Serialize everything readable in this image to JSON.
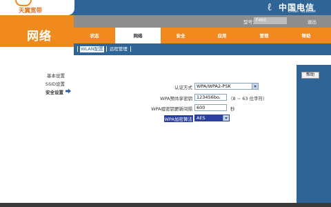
{
  "header": {
    "logo_text": "天翼宽带",
    "telecom_cn": "中国电信",
    "telecom_en": "CHINA TELECOM"
  },
  "section_title": "网络",
  "status_bar": {
    "model_label": "型号：",
    "model_value": "F460",
    "exit_label": "退出"
  },
  "main_tabs": [
    {
      "label": "状态",
      "active": false
    },
    {
      "label": "网络",
      "active": true
    },
    {
      "label": "安全",
      "active": false
    },
    {
      "label": "应用",
      "active": false
    },
    {
      "label": "管理",
      "active": false
    },
    {
      "label": "帮助",
      "active": false
    }
  ],
  "sub_tabs": [
    {
      "label": "WLAN配置",
      "active": true
    },
    {
      "label": "远程管理",
      "active": false
    }
  ],
  "left_menu": [
    {
      "label": "基本设置",
      "active": false
    },
    {
      "label": "SSID设置",
      "active": false
    },
    {
      "label": "安全设置",
      "active": true
    }
  ],
  "form": {
    "auth_label": "认证方式",
    "auth_value": "WPA/WPA2-PSK",
    "key_label": "WPA预共享密钥",
    "key_value": "123456bo.",
    "key_hint": "（8 ~ 63 位字符）",
    "rekey_label": "WPA组密钥更新间隔",
    "rekey_value": "600",
    "rekey_unit": "秒",
    "enc_label": "WPA加密算法",
    "enc_value": "AES"
  },
  "help_button": "帮助",
  "colors": {
    "brand_orange": "#f08a1c",
    "brand_blue": "#2f6496",
    "highlight_blue": "#2b3fa0"
  }
}
